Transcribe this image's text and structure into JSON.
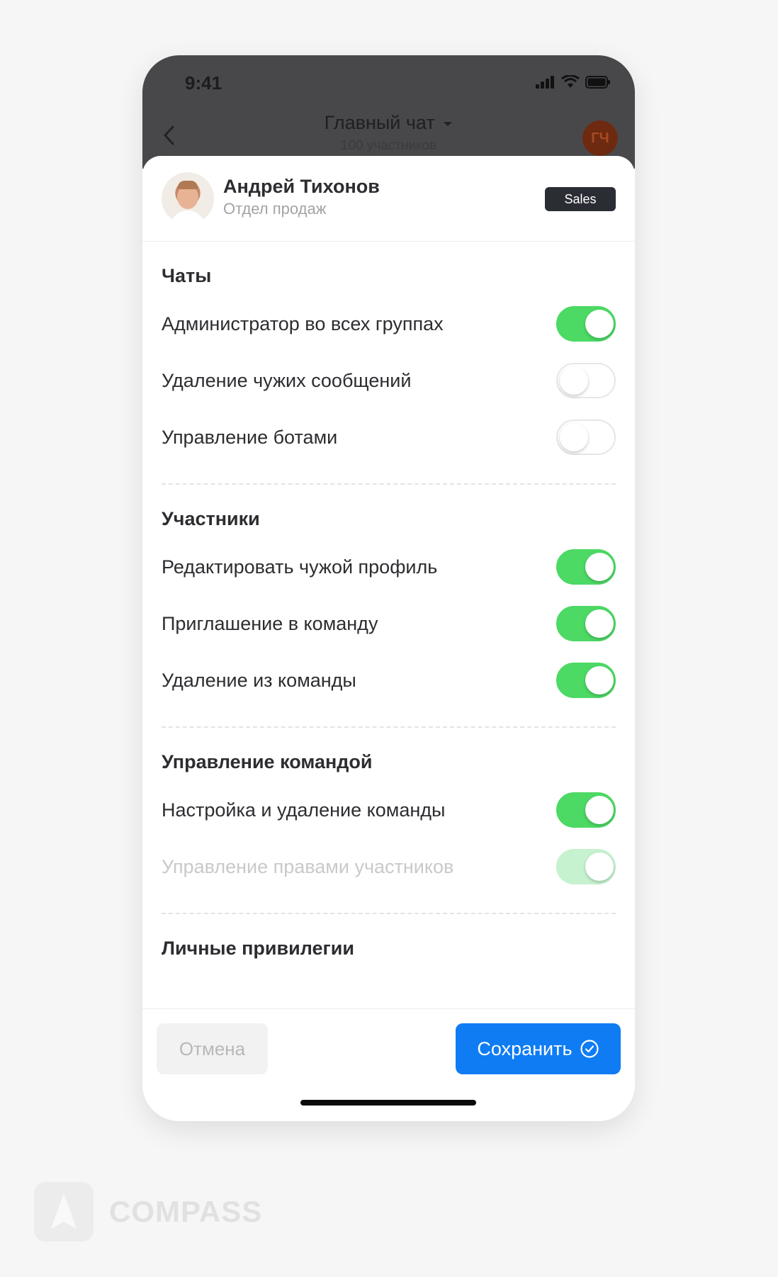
{
  "status": {
    "time": "9:41"
  },
  "chat": {
    "title": "Главный чат",
    "subtitle": "100 участников",
    "avatar_initials": "ГЧ"
  },
  "profile": {
    "name": "Андрей Тихонов",
    "department": "Отдел продаж",
    "badge": "Sales"
  },
  "sections": [
    {
      "title": "Чаты",
      "items": [
        {
          "label": "Администратор во всех группах",
          "enabled": true,
          "disabled": false
        },
        {
          "label": "Удаление чужих сообщений",
          "enabled": false,
          "disabled": false
        },
        {
          "label": "Управление ботами",
          "enabled": false,
          "disabled": false
        }
      ]
    },
    {
      "title": "Участники",
      "items": [
        {
          "label": "Редактировать чужой профиль",
          "enabled": true,
          "disabled": false
        },
        {
          "label": "Приглашение в команду",
          "enabled": true,
          "disabled": false
        },
        {
          "label": "Удаление из команды",
          "enabled": true,
          "disabled": false
        }
      ]
    },
    {
      "title": "Управление командой",
      "items": [
        {
          "label": "Настройка и удаление команды",
          "enabled": true,
          "disabled": false
        },
        {
          "label": "Управление правами участников",
          "enabled": true,
          "disabled": true
        }
      ]
    },
    {
      "title": "Личные привилегии",
      "items": []
    }
  ],
  "footer": {
    "cancel_label": "Отмена",
    "save_label": "Сохранить"
  },
  "brand": {
    "name": "COMPASS"
  },
  "colors": {
    "toggle_on": "#4cd964",
    "save_button": "#0f7cf4",
    "header_dim": "#48484a"
  },
  "icons": {
    "back": "chevron-left-icon",
    "save": "check-circle-icon",
    "dropdown": "caret-down-icon"
  }
}
